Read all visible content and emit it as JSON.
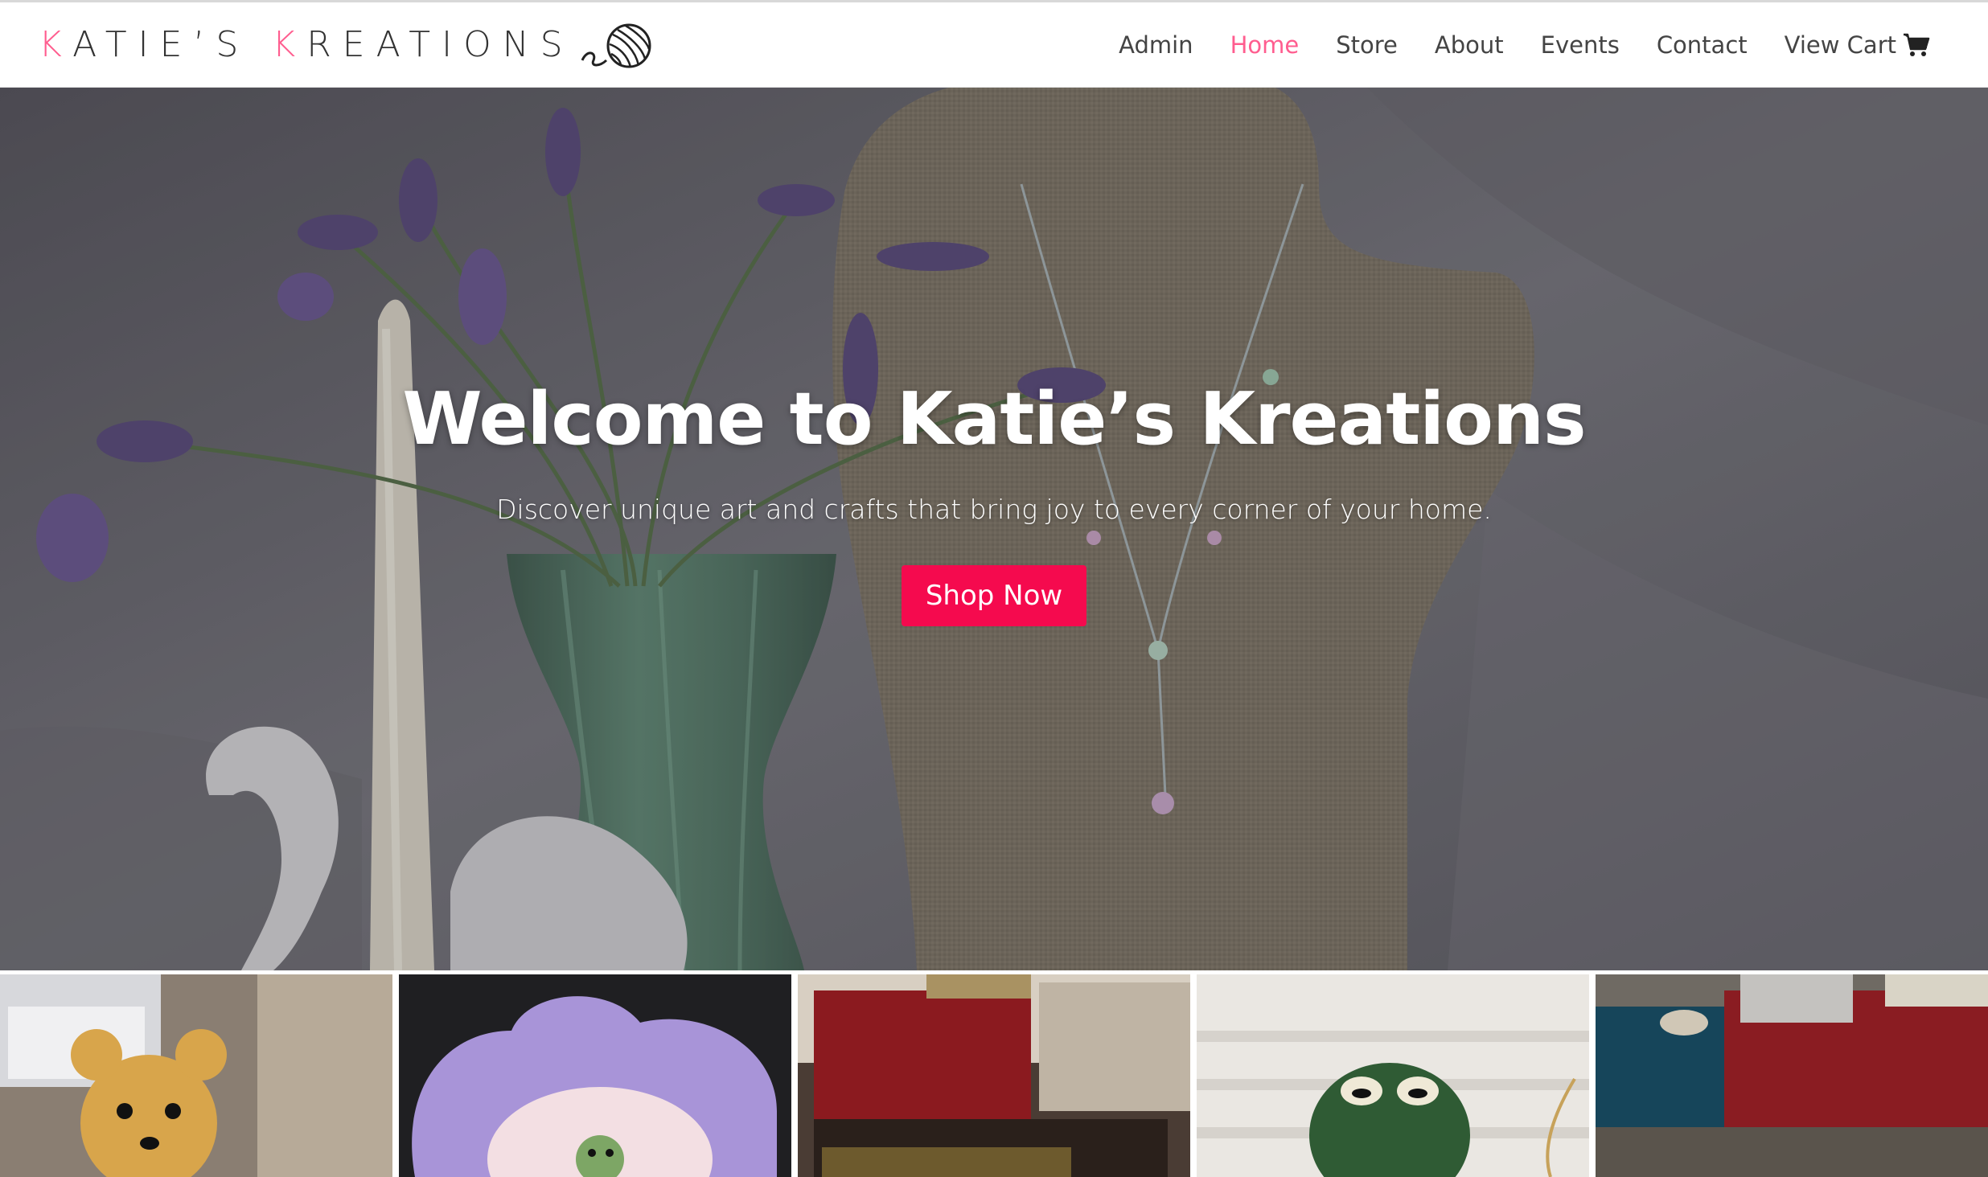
{
  "brand": {
    "first_initial": "K",
    "first_rest": "ATIE’S",
    "second_initial": "K",
    "second_rest": "REATIONS",
    "logo_icon": "yarn-ball-icon"
  },
  "nav": {
    "admin": "Admin",
    "home": "Home",
    "store": "Store",
    "about": "About",
    "events": "Events",
    "contact": "Contact",
    "cart": "View Cart",
    "cart_icon": "shopping-cart-icon",
    "active": "Home"
  },
  "hero": {
    "title": "Welcome to Katie’s Kreations",
    "subtitle": "Discover unique art and crafts that bring joy to every corner of your home.",
    "button": "Shop Now"
  },
  "gallery": {
    "items": [
      {
        "subject": "crochet-bear-photo"
      },
      {
        "subject": "cloud-mirror-photo"
      },
      {
        "subject": "framed-art-photo"
      },
      {
        "subject": "crochet-frog-photo"
      },
      {
        "subject": "craft-table-photo"
      }
    ]
  },
  "colors": {
    "accent": "#ff5d8f",
    "button": "#f50a4e",
    "nav_text": "#444444",
    "brand_text": "#333333"
  }
}
